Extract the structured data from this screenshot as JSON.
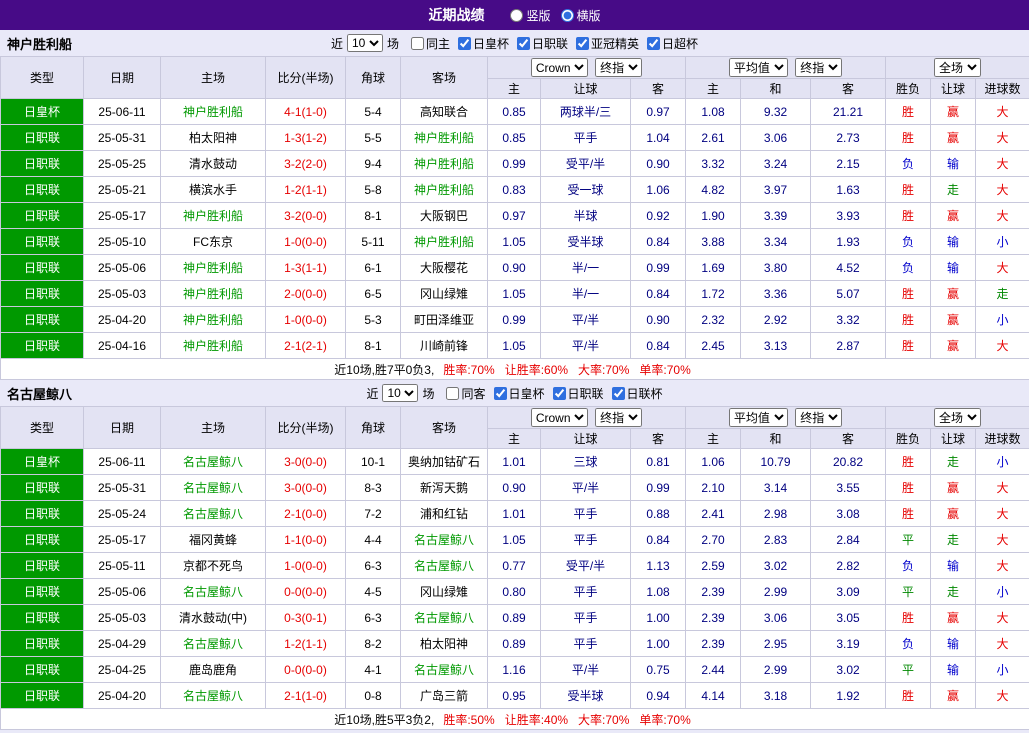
{
  "topbar": {
    "title": "近期战绩",
    "radios": [
      {
        "key": "vertical",
        "label": "竖版",
        "selected": false
      },
      {
        "key": "horizontal",
        "label": "横版",
        "selected": true
      }
    ]
  },
  "colors": {
    "topbar_bg": "#470b87",
    "page_bg": "#e9e9f8",
    "header_bg": "#e3e3f3",
    "border": "#c8c8dc",
    "type_badge_bg": "#009900",
    "focus_team": "#009900",
    "score": "#e60000",
    "odds": "#000080",
    "win": "#e60000",
    "push": "#008800",
    "loss": "#0000cc",
    "accent": "#2f6fdf",
    "summary_red": "#e60000"
  },
  "sections": [
    {
      "team": "神户胜利船",
      "filter": {
        "near_label": "近",
        "count": "10",
        "games_label": "场",
        "checkboxes": [
          {
            "key": "same-home",
            "label": "同主",
            "checked": false
          },
          {
            "key": "emperors-cup",
            "label": "日皇杯",
            "checked": true
          },
          {
            "key": "j1-league",
            "label": "日职联",
            "checked": true
          },
          {
            "key": "acl-elite",
            "label": "亚冠精英",
            "checked": true
          },
          {
            "key": "super-cup",
            "label": "日超杯",
            "checked": true
          }
        ]
      },
      "header": {
        "left_cols": [
          "类型",
          "日期",
          "主场",
          "比分(半场)",
          "角球",
          "客场"
        ],
        "group1": {
          "book": "Crown",
          "line": "终指",
          "sub": [
            "主",
            "让球",
            "客"
          ]
        },
        "group2": {
          "book": "平均值",
          "line": "终指",
          "sub": [
            "主",
            "和",
            "客"
          ]
        },
        "group3": {
          "scope": "全场",
          "sub": [
            "胜负",
            "让球",
            "进球数"
          ]
        }
      },
      "rows": [
        {
          "type": "日皇杯",
          "date": "25-06-11",
          "home": "神户胜利船",
          "home_focus": true,
          "score": "4-1(1-0)",
          "corners": "5-4",
          "away": "高知联合",
          "away_focus": false,
          "odds_home": "0.85",
          "handicap": "两球半/三",
          "odds_away": "0.97",
          "avg_home": "1.08",
          "avg_draw": "9.32",
          "avg_away": "21.21",
          "result": "胜",
          "handicap_result": "赢",
          "goals_result": "大"
        },
        {
          "type": "日职联",
          "date": "25-05-31",
          "home": "柏太阳神",
          "home_focus": false,
          "score": "1-3(1-2)",
          "corners": "5-5",
          "away": "神户胜利船",
          "away_focus": true,
          "odds_home": "0.85",
          "handicap": "平手",
          "odds_away": "1.04",
          "avg_home": "2.61",
          "avg_draw": "3.06",
          "avg_away": "2.73",
          "result": "胜",
          "handicap_result": "赢",
          "goals_result": "大"
        },
        {
          "type": "日职联",
          "date": "25-05-25",
          "home": "清水鼓动",
          "home_focus": false,
          "score": "3-2(2-0)",
          "corners": "9-4",
          "away": "神户胜利船",
          "away_focus": true,
          "odds_home": "0.99",
          "handicap": "受平/半",
          "odds_away": "0.90",
          "avg_home": "3.32",
          "avg_draw": "3.24",
          "avg_away": "2.15",
          "result": "负",
          "handicap_result": "输",
          "goals_result": "大"
        },
        {
          "type": "日职联",
          "date": "25-05-21",
          "home": "横滨水手",
          "home_focus": false,
          "score": "1-2(1-1)",
          "corners": "5-8",
          "away": "神户胜利船",
          "away_focus": true,
          "odds_home": "0.83",
          "handicap": "受一球",
          "odds_away": "1.06",
          "avg_home": "4.82",
          "avg_draw": "3.97",
          "avg_away": "1.63",
          "result": "胜",
          "handicap_result": "走",
          "goals_result": "大"
        },
        {
          "type": "日职联",
          "date": "25-05-17",
          "home": "神户胜利船",
          "home_focus": true,
          "score": "3-2(0-0)",
          "corners": "8-1",
          "away": "大阪钢巴",
          "away_focus": false,
          "odds_home": "0.97",
          "handicap": "半球",
          "odds_away": "0.92",
          "avg_home": "1.90",
          "avg_draw": "3.39",
          "avg_away": "3.93",
          "result": "胜",
          "handicap_result": "赢",
          "goals_result": "大"
        },
        {
          "type": "日职联",
          "date": "25-05-10",
          "home": "FC东京",
          "home_focus": false,
          "score": "1-0(0-0)",
          "corners": "5-11",
          "away": "神户胜利船",
          "away_focus": true,
          "odds_home": "1.05",
          "handicap": "受半球",
          "odds_away": "0.84",
          "avg_home": "3.88",
          "avg_draw": "3.34",
          "avg_away": "1.93",
          "result": "负",
          "handicap_result": "输",
          "goals_result": "小"
        },
        {
          "type": "日职联",
          "date": "25-05-06",
          "home": "神户胜利船",
          "home_focus": true,
          "score": "1-3(1-1)",
          "corners": "6-1",
          "away": "大阪樱花",
          "away_focus": false,
          "odds_home": "0.90",
          "handicap": "半/一",
          "odds_away": "0.99",
          "avg_home": "1.69",
          "avg_draw": "3.80",
          "avg_away": "4.52",
          "result": "负",
          "handicap_result": "输",
          "goals_result": "大"
        },
        {
          "type": "日职联",
          "date": "25-05-03",
          "home": "神户胜利船",
          "home_focus": true,
          "score": "2-0(0-0)",
          "corners": "6-5",
          "away": "冈山绿雉",
          "away_focus": false,
          "odds_home": "1.05",
          "handicap": "半/一",
          "odds_away": "0.84",
          "avg_home": "1.72",
          "avg_draw": "3.36",
          "avg_away": "5.07",
          "result": "胜",
          "handicap_result": "赢",
          "goals_result": "走"
        },
        {
          "type": "日职联",
          "date": "25-04-20",
          "home": "神户胜利船",
          "home_focus": true,
          "score": "1-0(0-0)",
          "corners": "5-3",
          "away": "町田泽维亚",
          "away_focus": false,
          "odds_home": "0.99",
          "handicap": "平/半",
          "odds_away": "0.90",
          "avg_home": "2.32",
          "avg_draw": "2.92",
          "avg_away": "3.32",
          "result": "胜",
          "handicap_result": "赢",
          "goals_result": "小"
        },
        {
          "type": "日职联",
          "date": "25-04-16",
          "home": "神户胜利船",
          "home_focus": true,
          "score": "2-1(2-1)",
          "corners": "8-1",
          "away": "川崎前锋",
          "away_focus": false,
          "odds_home": "1.05",
          "handicap": "平/半",
          "odds_away": "0.84",
          "avg_home": "2.45",
          "avg_draw": "3.13",
          "avg_away": "2.87",
          "result": "胜",
          "handicap_result": "赢",
          "goals_result": "大"
        }
      ],
      "summary": {
        "prefix": "近10场,胜7平0负3,",
        "stats": [
          "胜率:70%",
          "让胜率:60%",
          "大率:70%",
          "单率:70%"
        ]
      }
    },
    {
      "team": "名古屋鲸八",
      "filter": {
        "near_label": "近",
        "count": "10",
        "games_label": "场",
        "checkboxes": [
          {
            "key": "same-away",
            "label": "同客",
            "checked": false
          },
          {
            "key": "emperors-cup",
            "label": "日皇杯",
            "checked": true
          },
          {
            "key": "j1-league",
            "label": "日职联",
            "checked": true
          },
          {
            "key": "league-cup",
            "label": "日联杯",
            "checked": true
          }
        ]
      },
      "header": {
        "left_cols": [
          "类型",
          "日期",
          "主场",
          "比分(半场)",
          "角球",
          "客场"
        ],
        "group1": {
          "book": "Crown",
          "line": "终指",
          "sub": [
            "主",
            "让球",
            "客"
          ]
        },
        "group2": {
          "book": "平均值",
          "line": "终指",
          "sub": [
            "主",
            "和",
            "客"
          ]
        },
        "group3": {
          "scope": "全场",
          "sub": [
            "胜负",
            "让球",
            "进球数"
          ]
        }
      },
      "rows": [
        {
          "type": "日皇杯",
          "date": "25-06-11",
          "home": "名古屋鲸八",
          "home_focus": true,
          "score": "3-0(0-0)",
          "corners": "10-1",
          "away": "奥纳加钴矿石",
          "away_focus": false,
          "odds_home": "1.01",
          "handicap": "三球",
          "odds_away": "0.81",
          "avg_home": "1.06",
          "avg_draw": "10.79",
          "avg_away": "20.82",
          "result": "胜",
          "handicap_result": "走",
          "goals_result": "小"
        },
        {
          "type": "日职联",
          "date": "25-05-31",
          "home": "名古屋鲸八",
          "home_focus": true,
          "score": "3-0(0-0)",
          "corners": "8-3",
          "away": "新泻天鹅",
          "away_focus": false,
          "odds_home": "0.90",
          "handicap": "平/半",
          "odds_away": "0.99",
          "avg_home": "2.10",
          "avg_draw": "3.14",
          "avg_away": "3.55",
          "result": "胜",
          "handicap_result": "赢",
          "goals_result": "大"
        },
        {
          "type": "日职联",
          "date": "25-05-24",
          "home": "名古屋鲸八",
          "home_focus": true,
          "score": "2-1(0-0)",
          "corners": "7-2",
          "away": "浦和红钻",
          "away_focus": false,
          "odds_home": "1.01",
          "handicap": "平手",
          "odds_away": "0.88",
          "avg_home": "2.41",
          "avg_draw": "2.98",
          "avg_away": "3.08",
          "result": "胜",
          "handicap_result": "赢",
          "goals_result": "大"
        },
        {
          "type": "日职联",
          "date": "25-05-17",
          "home": "福冈黄蜂",
          "home_focus": false,
          "score": "1-1(0-0)",
          "corners": "4-4",
          "away": "名古屋鲸八",
          "away_focus": true,
          "odds_home": "1.05",
          "handicap": "平手",
          "odds_away": "0.84",
          "avg_home": "2.70",
          "avg_draw": "2.83",
          "avg_away": "2.84",
          "result": "平",
          "handicap_result": "走",
          "goals_result": "大"
        },
        {
          "type": "日职联",
          "date": "25-05-11",
          "home": "京都不死鸟",
          "home_focus": false,
          "score": "1-0(0-0)",
          "corners": "6-3",
          "away": "名古屋鲸八",
          "away_focus": true,
          "odds_home": "0.77",
          "handicap": "受平/半",
          "odds_away": "1.13",
          "avg_home": "2.59",
          "avg_draw": "3.02",
          "avg_away": "2.82",
          "result": "负",
          "handicap_result": "输",
          "goals_result": "大"
        },
        {
          "type": "日职联",
          "date": "25-05-06",
          "home": "名古屋鲸八",
          "home_focus": true,
          "score": "0-0(0-0)",
          "corners": "4-5",
          "away": "冈山绿雉",
          "away_focus": false,
          "odds_home": "0.80",
          "handicap": "平手",
          "odds_away": "1.08",
          "avg_home": "2.39",
          "avg_draw": "2.99",
          "avg_away": "3.09",
          "result": "平",
          "handicap_result": "走",
          "goals_result": "小"
        },
        {
          "type": "日职联",
          "date": "25-05-03",
          "home": "清水鼓动(中)",
          "home_focus": false,
          "score": "0-3(0-1)",
          "corners": "6-3",
          "away": "名古屋鲸八",
          "away_focus": true,
          "odds_home": "0.89",
          "handicap": "平手",
          "odds_away": "1.00",
          "avg_home": "2.39",
          "avg_draw": "3.06",
          "avg_away": "3.05",
          "result": "胜",
          "handicap_result": "赢",
          "goals_result": "大"
        },
        {
          "type": "日职联",
          "date": "25-04-29",
          "home": "名古屋鲸八",
          "home_focus": true,
          "score": "1-2(1-1)",
          "corners": "8-2",
          "away": "柏太阳神",
          "away_focus": false,
          "odds_home": "0.89",
          "handicap": "平手",
          "odds_away": "1.00",
          "avg_home": "2.39",
          "avg_draw": "2.95",
          "avg_away": "3.19",
          "result": "负",
          "handicap_result": "输",
          "goals_result": "大"
        },
        {
          "type": "日职联",
          "date": "25-04-25",
          "home": "鹿岛鹿角",
          "home_focus": false,
          "score": "0-0(0-0)",
          "corners": "4-1",
          "away": "名古屋鲸八",
          "away_focus": true,
          "odds_home": "1.16",
          "handicap": "平/半",
          "odds_away": "0.75",
          "avg_home": "2.44",
          "avg_draw": "2.99",
          "avg_away": "3.02",
          "result": "平",
          "handicap_result": "输",
          "goals_result": "小"
        },
        {
          "type": "日职联",
          "date": "25-04-20",
          "home": "名古屋鲸八",
          "home_focus": true,
          "score": "2-1(1-0)",
          "corners": "0-8",
          "away": "广岛三箭",
          "away_focus": false,
          "odds_home": "0.95",
          "handicap": "受半球",
          "odds_away": "0.94",
          "avg_home": "4.14",
          "avg_draw": "3.18",
          "avg_away": "1.92",
          "result": "胜",
          "handicap_result": "赢",
          "goals_result": "大"
        }
      ],
      "summary": {
        "prefix": "近10场,胜5平3负2,",
        "stats": [
          "胜率:50%",
          "让胜率:40%",
          "大率:70%",
          "单率:70%"
        ]
      }
    }
  ]
}
